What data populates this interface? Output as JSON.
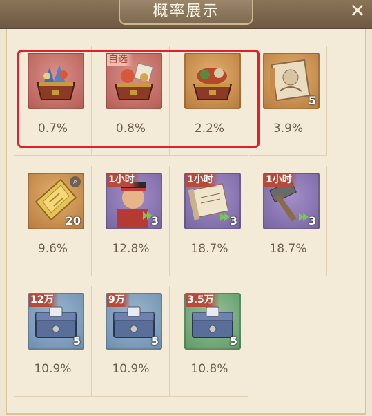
{
  "title": "概率展示",
  "close_icon_name": "close-icon",
  "rows": [
    [
      {
        "percent": "0.7%",
        "bg": "red",
        "icon": "gem-chest-icon"
      },
      {
        "percent": "0.8%",
        "bg": "red",
        "icon": "selectable-chest-icon",
        "tag": "自选",
        "tag_style": "light"
      },
      {
        "percent": "2.2%",
        "bg": "gold",
        "icon": "treasure-chest-icon"
      },
      {
        "percent": "3.9%",
        "bg": "gold",
        "icon": "scroll-bundle-icon",
        "count": "5"
      }
    ],
    [
      {
        "percent": "9.6%",
        "bg": "gold",
        "icon": "gold-ingot-icon",
        "count": "20",
        "magnifier": true
      },
      {
        "percent": "12.8%",
        "bg": "purple",
        "icon": "official-speedup-icon",
        "tag": "1小时",
        "count": "3"
      },
      {
        "percent": "18.7%",
        "bg": "purple",
        "icon": "scroll-speedup-icon",
        "tag": "1小时",
        "count": "3"
      },
      {
        "percent": "18.7%",
        "bg": "purple",
        "icon": "hammer-speedup-icon",
        "tag": "1小时",
        "count": "3"
      }
    ],
    [
      {
        "percent": "10.9%",
        "bg": "blue",
        "icon": "silver-chest-icon",
        "tag": "12万",
        "count": "5"
      },
      {
        "percent": "10.9%",
        "bg": "blue",
        "icon": "silver-chest-icon",
        "tag": "9万",
        "count": "5"
      },
      {
        "percent": "10.8%",
        "bg": "green",
        "icon": "silver-chest-icon",
        "tag": "3.5万",
        "count": "5"
      }
    ]
  ]
}
